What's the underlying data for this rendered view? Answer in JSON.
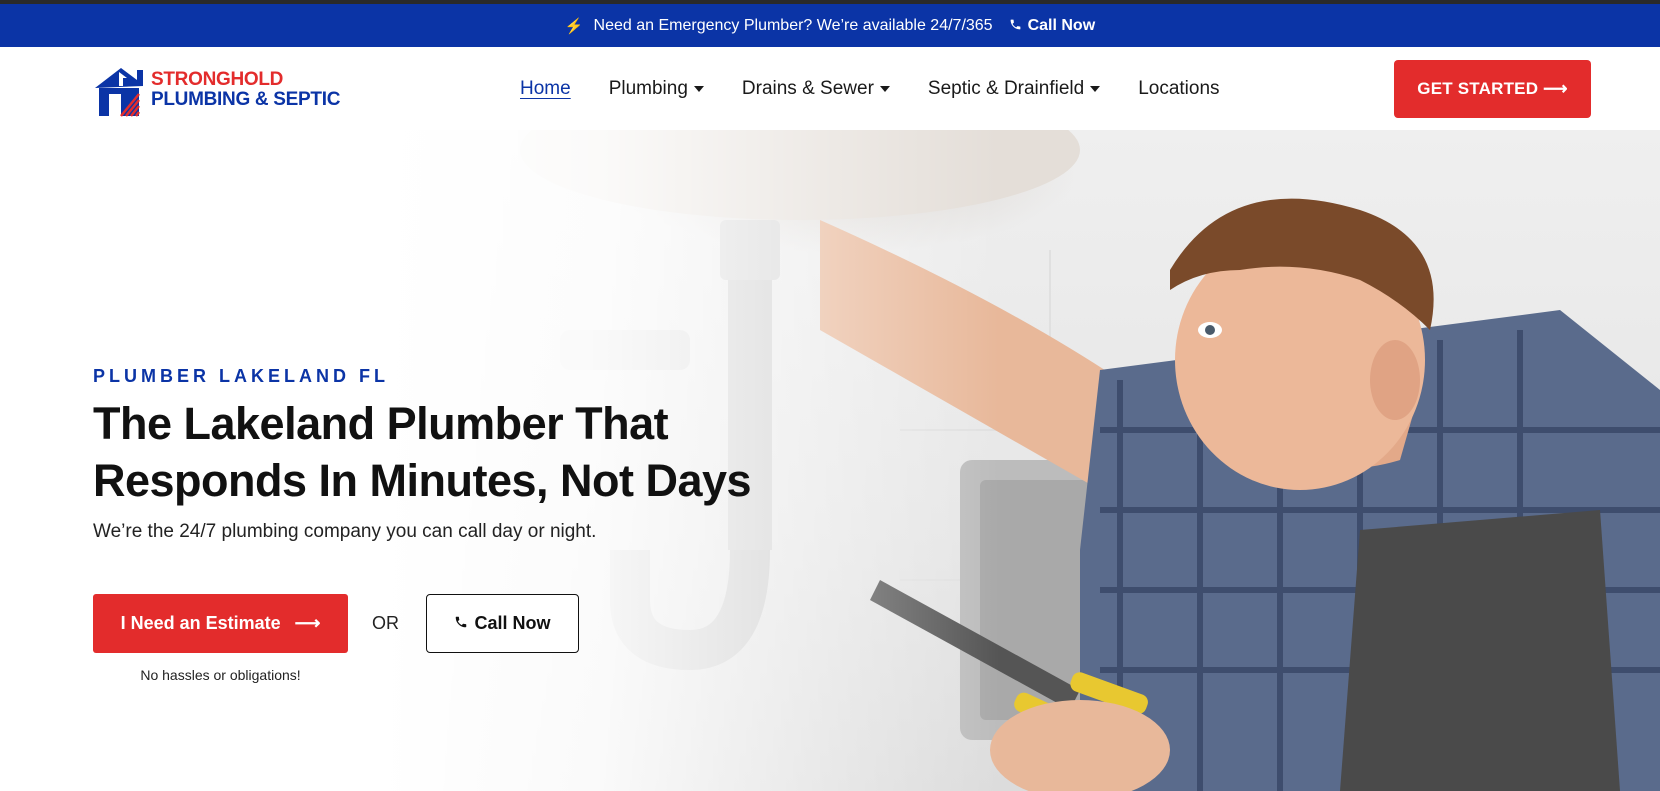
{
  "announcement": {
    "bolt_icon": "lightning-icon",
    "text": "Need an Emergency Plumber? We’re available 24/7/365",
    "phone_icon": "phone-icon",
    "call_label": "Call Now"
  },
  "brand": {
    "line1": "STRONGHOLD",
    "line2": "PLUMBING & SEPTIC",
    "red": "#e32c2c",
    "blue": "#0b34a6"
  },
  "nav": {
    "items": [
      {
        "label": "Home",
        "active": true,
        "dropdown": false
      },
      {
        "label": "Plumbing",
        "dropdown": true
      },
      {
        "label": "Drains & Sewer",
        "dropdown": true
      },
      {
        "label": "Septic & Drainfield",
        "dropdown": true
      },
      {
        "label": "Locations",
        "dropdown": false
      }
    ],
    "cta_label": "GET STARTED ⟶"
  },
  "hero": {
    "eyebrow": "PLUMBER LAKELAND FL",
    "headline": "The Lakeland Plumber That Responds In Minutes, Not Days",
    "subline": "We’re the 24/7 plumbing company you can call day or night.",
    "estimate_label": "I Need an Estimate",
    "or_text": "OR",
    "call_label": "Call Now",
    "note": "No hassles or obligations!"
  }
}
